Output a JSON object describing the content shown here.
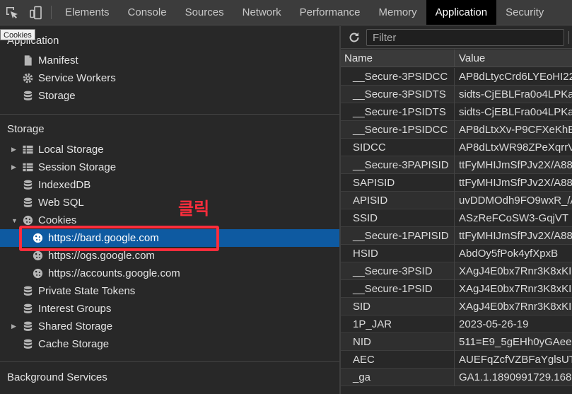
{
  "tabs": [
    "Elements",
    "Console",
    "Sources",
    "Network",
    "Performance",
    "Memory",
    "Application",
    "Security"
  ],
  "active_tab": "Application",
  "tooltip": "Cookies",
  "sidebar": {
    "application_header": "Application",
    "application_items": [
      "Manifest",
      "Service Workers",
      "Storage"
    ],
    "storage_header": "Storage",
    "storage_items": {
      "local_storage": "Local Storage",
      "session_storage": "Session Storage",
      "indexeddb": "IndexedDB",
      "web_sql": "Web SQL",
      "cookies": "Cookies",
      "cookie_bard": "https://bard.google.com",
      "cookie_ogs": "https://ogs.google.com",
      "cookie_accounts": "https://accounts.google.com",
      "private_state_tokens": "Private State Tokens",
      "interest_groups": "Interest Groups",
      "shared_storage": "Shared Storage",
      "cache_storage": "Cache Storage"
    },
    "background_header": "Background Services"
  },
  "annotation": {
    "text": "클릭",
    "color": "#ff2d3c"
  },
  "filter": {
    "placeholder": "Filter",
    "value": ""
  },
  "table": {
    "headers": {
      "name": "Name",
      "value": "Value"
    },
    "rows": [
      {
        "name": "__Secure-3PSIDCC",
        "value": "AP8dLtycCrd6LYEoHI22"
      },
      {
        "name": "__Secure-3PSIDTS",
        "value": "sidts-CjEBLFra0o4LPKa"
      },
      {
        "name": "__Secure-1PSIDTS",
        "value": "sidts-CjEBLFra0o4LPKa"
      },
      {
        "name": "__Secure-1PSIDCC",
        "value": "AP8dLtxXv-P9CFXeKhE"
      },
      {
        "name": "SIDCC",
        "value": "AP8dLtxWR98ZPeXqrrV"
      },
      {
        "name": "__Secure-3PAPISID",
        "value": "ttFyMHIJmSfPJv2X/A88"
      },
      {
        "name": "SAPISID",
        "value": "ttFyMHIJmSfPJv2X/A88"
      },
      {
        "name": "APISID",
        "value": "uvDDMOdh9FO9wxR_/A"
      },
      {
        "name": "SSID",
        "value": "ASzReFCoSW3-GqjVT"
      },
      {
        "name": "__Secure-1PAPISID",
        "value": "ttFyMHIJmSfPJv2X/A88"
      },
      {
        "name": "HSID",
        "value": "AbdOy5fPok4yfXpxB"
      },
      {
        "name": "__Secure-3PSID",
        "value": "XAgJ4E0bx7Rnr3K8xKI"
      },
      {
        "name": "__Secure-1PSID",
        "value": "XAgJ4E0bx7Rnr3K8xKI"
      },
      {
        "name": "SID",
        "value": "XAgJ4E0bx7Rnr3K8xKI"
      },
      {
        "name": "1P_JAR",
        "value": "2023-05-26-19"
      },
      {
        "name": "NID",
        "value": "511=E9_5gEHh0yGAee"
      },
      {
        "name": "AEC",
        "value": "AUEFqZcfVZBFaYglsUT"
      },
      {
        "name": "_ga",
        "value": "GA1.1.1890991729.168"
      }
    ]
  },
  "colors": {
    "selected_row": "#0e5aa1",
    "highlight": "#ff2d3c",
    "active_tab_bg": "#000000"
  }
}
